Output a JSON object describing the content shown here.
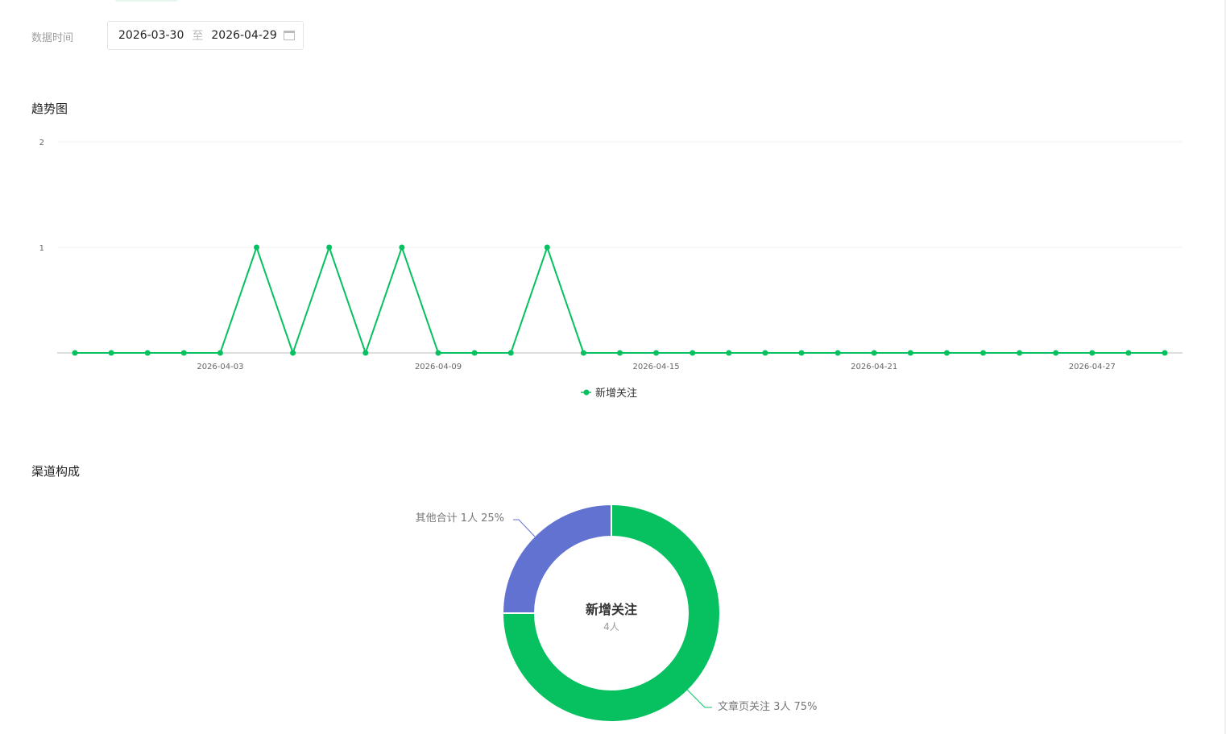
{
  "filter": {
    "label": "数据时间",
    "start": "2026-03-30",
    "separator": "至",
    "end": "2026-04-29"
  },
  "trend": {
    "title": "趋势图"
  },
  "channel": {
    "title": "渠道构成"
  },
  "colors": {
    "green": "#07c160",
    "blue": "#6272d0"
  },
  "chart_data": [
    {
      "type": "line",
      "title": "趋势图",
      "legend": [
        "新增关注"
      ],
      "legend_position": "bottom",
      "ylim": [
        0,
        2
      ],
      "yticks": [
        "1",
        "2"
      ],
      "x": [
        "2026-03-30",
        "2026-03-31",
        "2026-04-01",
        "2026-04-02",
        "2026-04-03",
        "2026-04-04",
        "2026-04-05",
        "2026-04-06",
        "2026-04-07",
        "2026-04-08",
        "2026-04-09",
        "2026-04-10",
        "2026-04-11",
        "2026-04-12",
        "2026-04-13",
        "2026-04-14",
        "2026-04-15",
        "2026-04-16",
        "2026-04-17",
        "2026-04-18",
        "2026-04-19",
        "2026-04-20",
        "2026-04-21",
        "2026-04-22",
        "2026-04-23",
        "2026-04-24",
        "2026-04-25",
        "2026-04-26",
        "2026-04-27",
        "2026-04-28",
        "2026-04-29"
      ],
      "xticks": [
        "2026-04-03",
        "2026-04-09",
        "2026-04-15",
        "2026-04-21",
        "2026-04-27"
      ],
      "series": [
        {
          "name": "新增关注",
          "values": [
            0,
            0,
            0,
            0,
            0,
            1,
            0,
            1,
            0,
            1,
            0,
            0,
            0,
            1,
            0,
            0,
            0,
            0,
            0,
            0,
            0,
            0,
            0,
            0,
            0,
            0,
            0,
            0,
            0,
            0,
            0
          ]
        }
      ]
    },
    {
      "type": "pie",
      "title": "渠道构成",
      "center_title": "新增关注",
      "center_value": "4人",
      "slices": [
        {
          "name": "文章页关注",
          "value": 3,
          "label": "文章页关注 3人 75%"
        },
        {
          "name": "其他合计",
          "value": 1,
          "label": "其他合计 1人 25%"
        }
      ]
    }
  ]
}
